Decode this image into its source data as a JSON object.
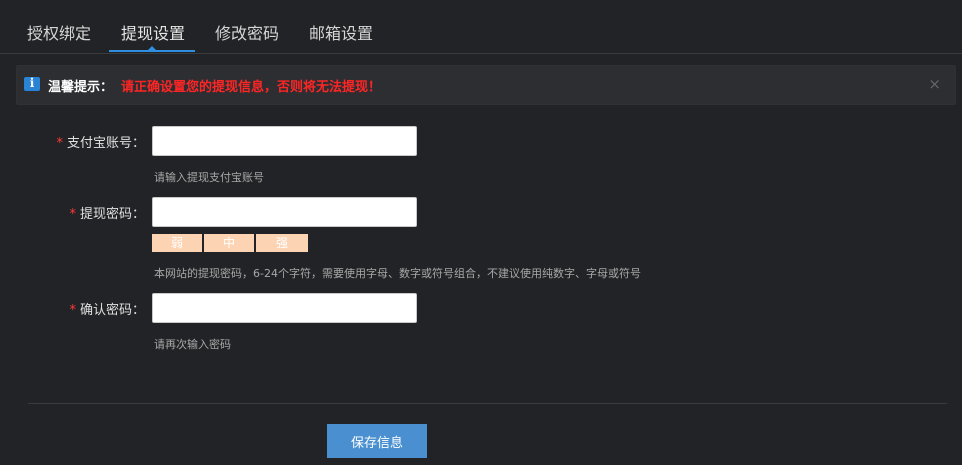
{
  "tabs": [
    {
      "label": "授权绑定"
    },
    {
      "label": "提现设置"
    },
    {
      "label": "修改密码"
    },
    {
      "label": "邮箱设置"
    }
  ],
  "alert": {
    "title": "温馨提示：",
    "message": "请正确设置您的提现信息，否则将无法提现！",
    "close": "×"
  },
  "form": {
    "required_mark": "*",
    "alipay": {
      "label": "支付宝账号：",
      "value": "",
      "hint": "请输入提现支付宝账号"
    },
    "withdraw_password": {
      "label": "提现密码：",
      "value": "",
      "strength": [
        "弱",
        "中",
        "强"
      ],
      "hint": "本网站的提现密码，6-24个字符，需要使用字母、数字或符号组合，不建议使用纯数字、字母或符号"
    },
    "confirm_password": {
      "label": "确认密码：",
      "value": "",
      "hint": "请再次输入密码"
    }
  },
  "actions": {
    "save_label": "保存信息"
  },
  "colors": {
    "accent": "#2f8ee0",
    "alert_text": "#ff2525",
    "required": "#ff3a3a",
    "button": "#4a90d0",
    "strength_bg": "#fcd4b4"
  }
}
